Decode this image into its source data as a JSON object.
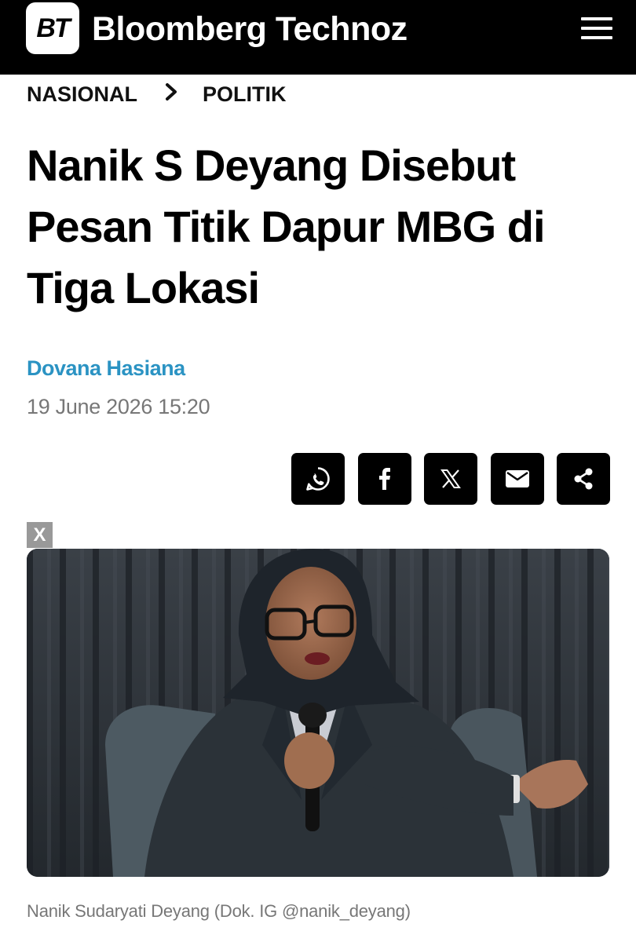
{
  "header": {
    "logo_text": "BT",
    "brand_name": "Bloomberg Technoz",
    "menu_icon": "hamburger-menu-icon",
    "background_color": "#000000"
  },
  "breadcrumb": {
    "items": [
      {
        "label": "NASIONAL"
      },
      {
        "label": "POLITIK"
      }
    ],
    "separator_icon": "chevron-right-icon"
  },
  "article": {
    "title": "Nanik S Deyang Disebut Pesan Titik Dapur MBG di Tiga Lokasi",
    "author": "Dovana Hasiana",
    "datetime": "19 June 2026 15:20",
    "author_color": "#2b93c3"
  },
  "share": {
    "buttons": [
      {
        "icon": "whatsapp-icon"
      },
      {
        "icon": "facebook-icon"
      },
      {
        "icon": "x-twitter-icon"
      },
      {
        "icon": "email-icon"
      },
      {
        "icon": "share-icon"
      }
    ]
  },
  "ad": {
    "close_label": "X"
  },
  "photo": {
    "caption": "Nanik Sudaryati Deyang (Dok. IG @nanik_deyang)"
  }
}
